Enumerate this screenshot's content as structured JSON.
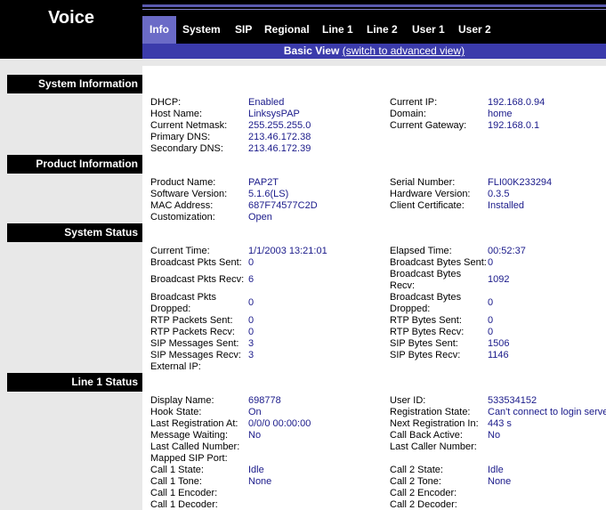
{
  "logo": {
    "title": "Voice"
  },
  "tabs": [
    "Info",
    "System",
    "SIP",
    "Regional",
    "Line 1",
    "Line 2",
    "User 1",
    "User 2"
  ],
  "viewbar": {
    "label": "Basic View",
    "link": "(switch to advanced view)"
  },
  "sections": {
    "system_information": "System Information",
    "product_information": "Product Information",
    "system_status": "System Status",
    "line1_status": "Line 1 Status"
  },
  "sysinfo": {
    "dhcp_label": "DHCP:",
    "dhcp": "Enabled",
    "host_label": "Host Name:",
    "host": "LinksysPAP",
    "netmask_label": "Current Netmask:",
    "netmask": "255.255.255.0",
    "pdns_label": "Primary DNS:",
    "pdns": "213.46.172.38",
    "sdns_label": "Secondary DNS:",
    "sdns": "213.46.172.39",
    "ip_label": "Current IP:",
    "ip": "192.168.0.94",
    "domain_label": "Domain:",
    "domain": "home",
    "gw_label": "Current Gateway:",
    "gw": "192.168.0.1"
  },
  "prodinfo": {
    "product_label": "Product Name:",
    "product": "PAP2T",
    "sw_label": "Software Version:",
    "sw": "5.1.6(LS)",
    "mac_label": "MAC Address:",
    "mac": "687F74577C2D",
    "cust_label": "Customization:",
    "cust": "Open",
    "serial_label": "Serial Number:",
    "serial": "FLI00K233294",
    "hw_label": "Hardware Version:",
    "hw": "0.3.5",
    "cert_label": "Client Certificate:",
    "cert": "Installed"
  },
  "sysstatus": {
    "time_label": "Current Time:",
    "time": "1/1/2003 13:21:01",
    "bps_label": "Broadcast Pkts Sent:",
    "bps": "0",
    "bpr_label": "Broadcast Pkts Recv:",
    "bpr": "6",
    "bpd_label1": "Broadcast Pkts",
    "bpd_label2": "Dropped:",
    "bpd": "0",
    "rps_label": "RTP Packets Sent:",
    "rps": "0",
    "rpr_label": "RTP Packets Recv:",
    "rpr": "0",
    "sms_label": "SIP Messages Sent:",
    "sms": "3",
    "smr_label": "SIP Messages Recv:",
    "smr": "3",
    "extip_label": "External IP:",
    "elapsed_label": "Elapsed Time:",
    "elapsed": "00:52:37",
    "bbs_label": "Broadcast Bytes Sent:",
    "bbs": "0",
    "bbr_label1": "Broadcast Bytes",
    "bbr_label2": "Recv:",
    "bbr": "1092",
    "bbd_label1": "Broadcast Bytes",
    "bbd_label2": "Dropped:",
    "bbd": "0",
    "rbs_label": "RTP Bytes Sent:",
    "rbs": "0",
    "rbr_label": "RTP Bytes Recv:",
    "rbr": "0",
    "sbs_label": "SIP Bytes Sent:",
    "sbs": "1506",
    "sbr_label": "SIP Bytes Recv:",
    "sbr": "1146"
  },
  "line1": {
    "display_label": "Display Name:",
    "display": "698778",
    "hook_label": "Hook State:",
    "hook": "On",
    "lastreg_label": "Last Registration At:",
    "lastreg": "0/0/0 00:00:00",
    "mw_label": "Message Waiting:",
    "mw": "No",
    "lcn_label": "Last Called Number:",
    "msp_label": "Mapped SIP Port:",
    "c1s_label": "Call 1 State:",
    "c1s": "Idle",
    "c1t_label": "Call 1 Tone:",
    "c1t": "None",
    "c1e_label": "Call 1 Encoder:",
    "c1d_label": "Call 1 Decoder:",
    "uid_label": "User ID:",
    "uid": "533534152",
    "rs_label": "Registration State:",
    "rs": "Can't connect to login serve",
    "nr_label": "Next Registration In:",
    "nr": "443 s",
    "cba_label": "Call Back Active:",
    "cba": "No",
    "lcaller_label": "Last Caller Number:",
    "c2s_label": "Call 2 State:",
    "c2s": "Idle",
    "c2t_label": "Call 2 Tone:",
    "c2t": "None",
    "c2e_label": "Call 2 Encoder:",
    "c2d_label": "Call 2 Decoder:"
  }
}
